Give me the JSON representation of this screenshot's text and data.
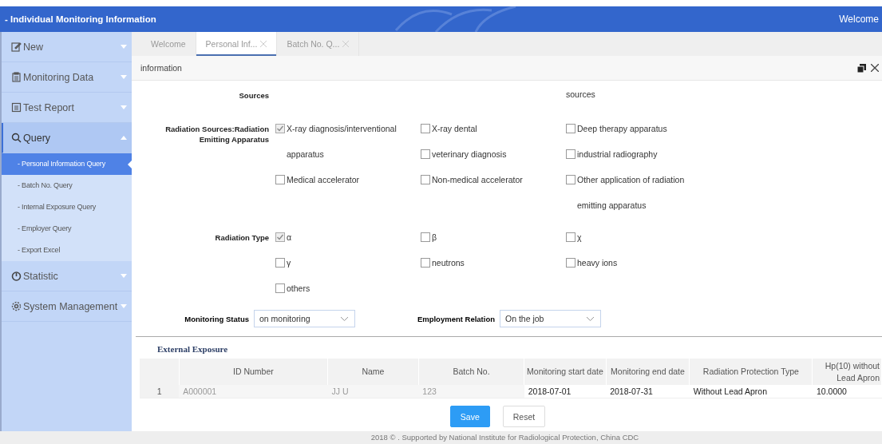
{
  "header": {
    "title": "- Individual Monitoring Information",
    "welcome": "Welcome"
  },
  "sidebar": [
    {
      "kind": "group",
      "label": "New",
      "expanded": false,
      "selected": false
    },
    {
      "kind": "group",
      "label": "Monitoring Data",
      "expanded": false,
      "selected": false
    },
    {
      "kind": "group",
      "label": "Test Report",
      "expanded": false,
      "selected": false
    },
    {
      "kind": "group",
      "label": "Query",
      "expanded": true,
      "selected": true
    },
    {
      "kind": "sub",
      "label": "- Personal Information Query",
      "selected": true
    },
    {
      "kind": "sub",
      "label": "- Batch No. Query",
      "selected": false
    },
    {
      "kind": "sub",
      "label": "- Internal Exposure Query",
      "selected": false
    },
    {
      "kind": "sub",
      "label": "- Employer Query",
      "selected": false
    },
    {
      "kind": "sub",
      "label": "- Export Excel",
      "selected": false
    },
    {
      "kind": "group",
      "label": "Statistic",
      "expanded": false,
      "selected": false
    },
    {
      "kind": "group",
      "label": "System Management",
      "expanded": false,
      "selected": false
    }
  ],
  "tabs": [
    {
      "label": "Welcome",
      "selected": false,
      "closable": false
    },
    {
      "label": "Personal Inf...",
      "selected": true,
      "closable": true
    },
    {
      "label": "Batch No. Q...",
      "selected": false,
      "closable": true
    }
  ],
  "panel": {
    "title": "information"
  },
  "cut_row": {
    "label": "Sources",
    "col3": "sources"
  },
  "groups": [
    {
      "label": "Radiation Sources:Radiation Emitting Apparatus",
      "columns": [
        [
          {
            "label": "X-ray diagnosis/interventional apparatus",
            "checked": true
          },
          {
            "label": "Medical accelerator",
            "checked": false
          }
        ],
        [
          {
            "label": "X-ray dental",
            "checked": false
          },
          {
            "label": "veterinary diagnosis",
            "checked": false
          },
          {
            "label": "Non-medical accelerator",
            "checked": false
          }
        ],
        [
          {
            "label": "Deep therapy apparatus",
            "checked": false
          },
          {
            "label": "industrial radiography",
            "checked": false
          },
          {
            "label": "Other application of radiation emitting apparatus",
            "checked": false
          }
        ]
      ]
    },
    {
      "label": "Radiation Type",
      "columns": [
        [
          {
            "label": "α",
            "checked": true
          },
          {
            "label": "γ",
            "checked": false
          },
          {
            "label": "others",
            "checked": false
          }
        ],
        [
          {
            "label": "β",
            "checked": false
          },
          {
            "label": "neutrons",
            "checked": false
          }
        ],
        [
          {
            "label": "χ",
            "checked": false
          },
          {
            "label": "heavy ions",
            "checked": false
          }
        ]
      ]
    }
  ],
  "selects": [
    {
      "label": "Monitoring Status",
      "value": "on monitoring"
    },
    {
      "label": "Employment Relation",
      "value": "On the job"
    }
  ],
  "section": "External Exposure",
  "table": {
    "columns": [
      "ID Number",
      "Name",
      "Batch No.",
      "Monitoring start date",
      "Monitoring end date",
      "Radiation Protection Type",
      "Hp(10) without Lead Apron"
    ],
    "rows": [
      {
        "index": "1",
        "cells": [
          {
            "text": "A000001",
            "editable": false
          },
          {
            "text": "JJ U",
            "editable": false
          },
          {
            "text": "123",
            "editable": false
          },
          {
            "text": "2018-07-01",
            "editable": true
          },
          {
            "text": "2018-07-31",
            "editable": true
          },
          {
            "text": "Without Lead Apron",
            "editable": true
          },
          {
            "text": "10.0000",
            "editable": true
          }
        ]
      }
    ]
  },
  "buttons": [
    {
      "label": "Save",
      "kind": "primary"
    },
    {
      "label": "Reset",
      "kind": "default"
    }
  ],
  "footer": "2018 © . Supported by National Institute for Radiological Protection, China CDC"
}
